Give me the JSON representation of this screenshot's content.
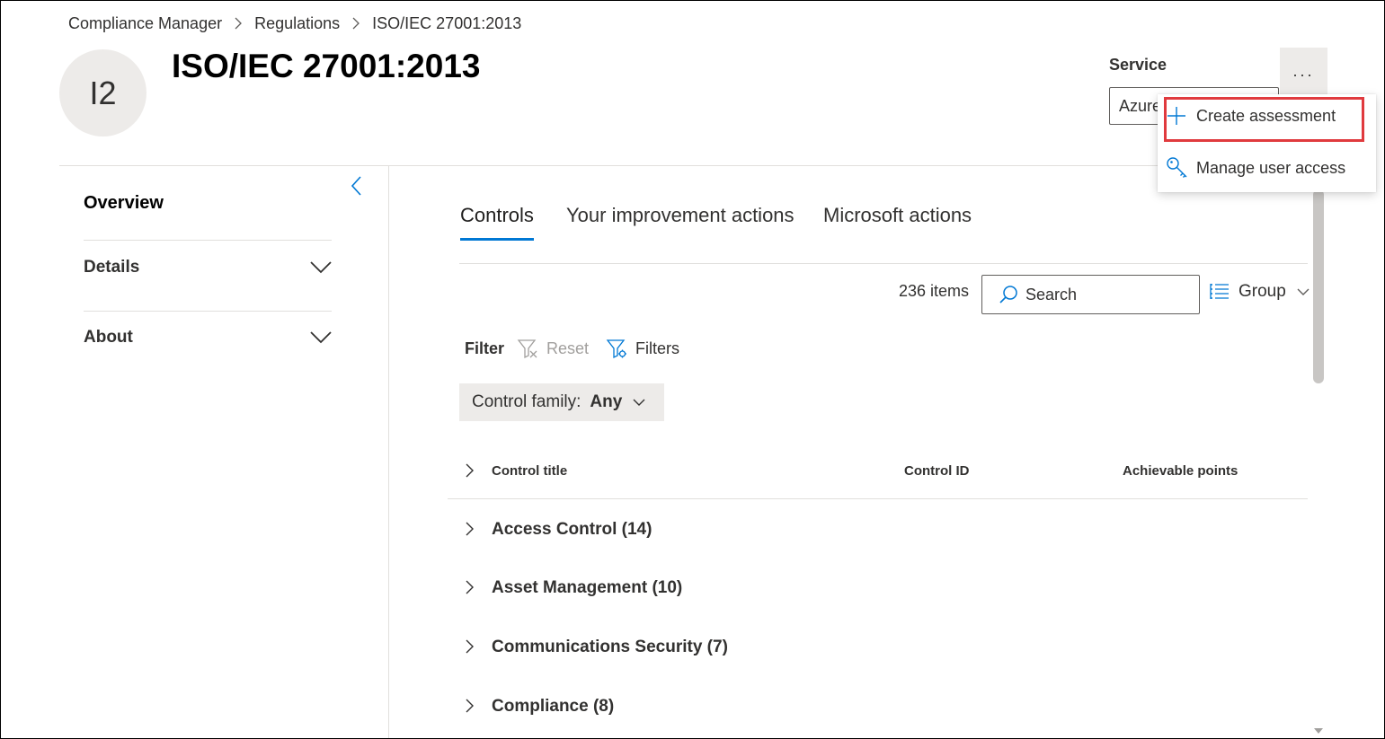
{
  "breadcrumb": [
    "Compliance Manager",
    "Regulations",
    "ISO/IEC 27001:2013"
  ],
  "header": {
    "avatar_initials": "I2",
    "title": "ISO/IEC 27001:2013",
    "service_label": "Service",
    "service_value": "Azure",
    "more_label": "..."
  },
  "menu": {
    "create": "Create assessment",
    "manage": "Manage user access"
  },
  "sidebar": {
    "overview": "Overview",
    "sections": [
      "Details",
      "About"
    ]
  },
  "tabs": [
    {
      "label": "Controls",
      "active": true
    },
    {
      "label": "Your improvement actions",
      "active": false
    },
    {
      "label": "Microsoft actions",
      "active": false
    }
  ],
  "toolbar": {
    "item_count": "236 items",
    "search_placeholder": "Search",
    "group_label": "Group"
  },
  "filter": {
    "label": "Filter",
    "reset": "Reset",
    "filters": "Filters",
    "pill_label": "Control family:",
    "pill_value": "Any"
  },
  "table": {
    "columns": [
      "Control title",
      "Control ID",
      "Achievable points"
    ],
    "rows": [
      {
        "title": "Access Control",
        "count": "(14)"
      },
      {
        "title": "Asset Management",
        "count": "(10)"
      },
      {
        "title": "Communications Security",
        "count": "(7)"
      },
      {
        "title": "Compliance",
        "count": "(8)"
      }
    ]
  },
  "colors": {
    "accent": "#0078d4",
    "highlight": "#e03a3e",
    "divider": "#e1dfdd",
    "pill_bg": "#edebe9"
  }
}
